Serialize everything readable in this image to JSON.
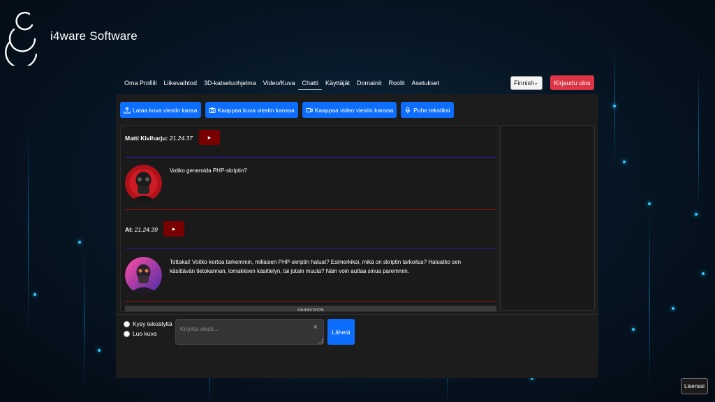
{
  "brand": {
    "name": "i4ware Software"
  },
  "nav": {
    "items": [
      {
        "label": "Oma Profiili"
      },
      {
        "label": "Liikevaihtod"
      },
      {
        "label": "3D-katseluohjelma"
      },
      {
        "label": "Video/Kuva"
      },
      {
        "label": "Chatti"
      },
      {
        "label": "Käyttäjät"
      },
      {
        "label": "Domainit"
      },
      {
        "label": "Roolit"
      },
      {
        "label": "Asetukset"
      }
    ],
    "active": "Chatti"
  },
  "header": {
    "language": "Finnish",
    "logout_label": "Kirjaudu ulos"
  },
  "toolbar": {
    "upload_label": "Lataa kuva viestin kassa",
    "capture_photo_label": "Kaappaa kuva viestin kanssa",
    "capture_video_label": "Kaappaa video viestin kanssa",
    "speech_label": "Puhe tekstiksi"
  },
  "chat": {
    "messages": [
      {
        "author": "Matti Kiviharju:",
        "time": "21.24.37",
        "text": "Voitko generoida PHP-skriptin?"
      },
      {
        "author": "AI:",
        "time": "21.24.39",
        "text": "Tottakai! Voitko kertoa tarkemmin, millaisen PHP-skriptin haluat? Esimerkiksi, mikä on skriptin tarkoitus? Haluatko sen käsittävän tietokannan, lomakkeen käsittelyn, tai jotain muuta? Näin voin auttaa sinua paremmin."
      }
    ],
    "date_separator": "06/05/2025"
  },
  "compose": {
    "option_ask_ai": "Kysy tekoälyltä",
    "option_create_image": "Luo kuva",
    "placeholder": "Kirjoita viesti...",
    "send_label": "Lähetä"
  },
  "footer": {
    "license_label": "Lisenssi"
  },
  "colors": {
    "primary": "#0d6efd",
    "danger": "#dc3545",
    "play_button": "#7a0000",
    "panel": "#1c1c1d"
  }
}
